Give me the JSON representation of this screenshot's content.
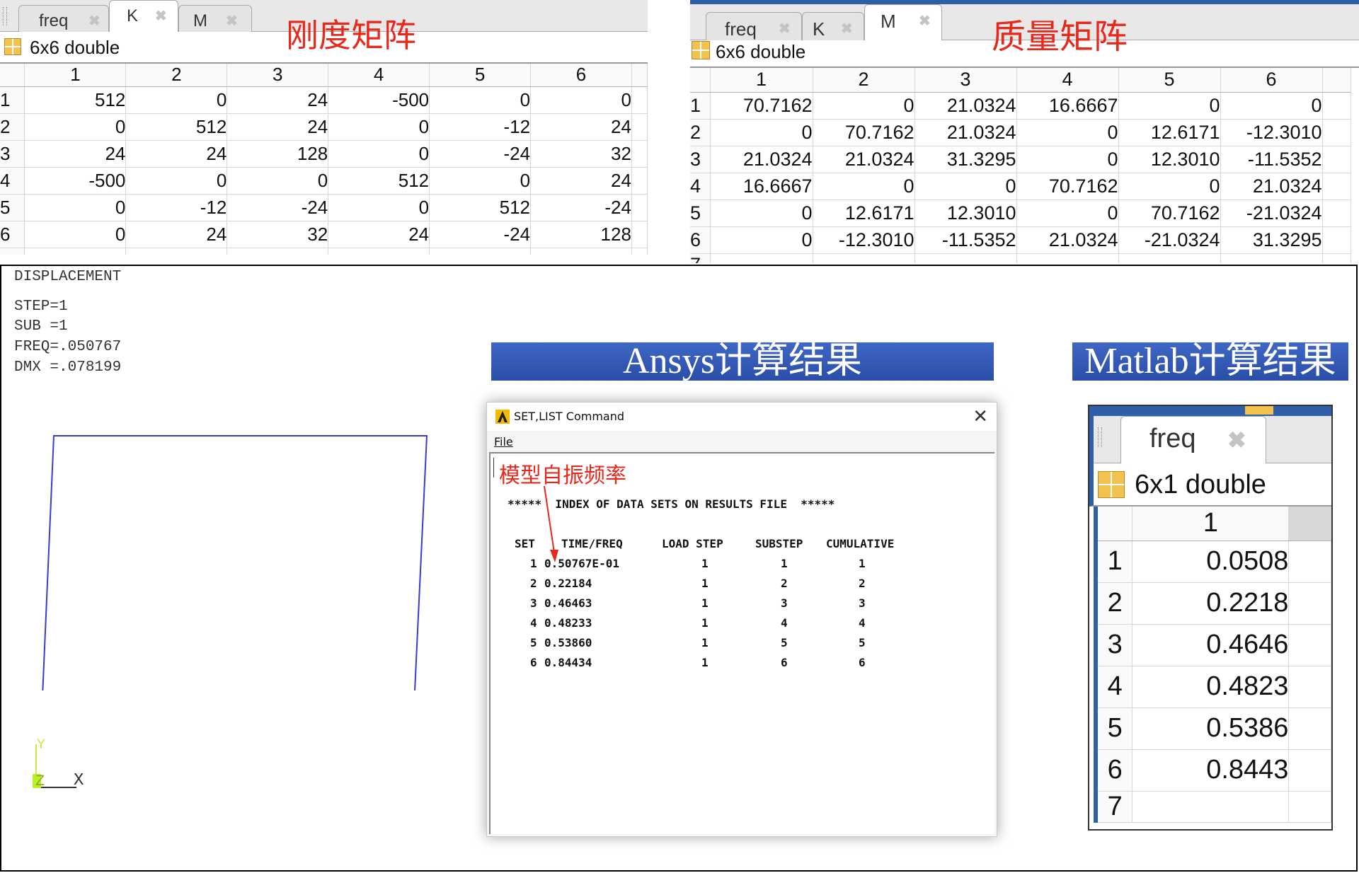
{
  "k_panel": {
    "tabs": [
      {
        "label": "freq",
        "close": "✖"
      },
      {
        "label": "K",
        "close": "✖"
      },
      {
        "label": "M",
        "close": "✖"
      }
    ],
    "active_tab": "K",
    "annotation": "刚度矩阵",
    "size_label": "6x6 double",
    "columns": [
      "1",
      "2",
      "3",
      "4",
      "5",
      "6"
    ],
    "rows": [
      {
        "idx": "1",
        "cells": [
          "512",
          "0",
          "24",
          "-500",
          "0",
          "0"
        ]
      },
      {
        "idx": "2",
        "cells": [
          "0",
          "512",
          "24",
          "0",
          "-12",
          "24"
        ]
      },
      {
        "idx": "3",
        "cells": [
          "24",
          "24",
          "128",
          "0",
          "-24",
          "32"
        ]
      },
      {
        "idx": "4",
        "cells": [
          "-500",
          "0",
          "0",
          "512",
          "0",
          "24"
        ]
      },
      {
        "idx": "5",
        "cells": [
          "0",
          "-12",
          "-24",
          "0",
          "512",
          "-24"
        ]
      },
      {
        "idx": "6",
        "cells": [
          "0",
          "24",
          "32",
          "24",
          "-24",
          "128"
        ]
      }
    ]
  },
  "m_panel": {
    "tabs": [
      {
        "label": "freq",
        "close": "✖"
      },
      {
        "label": "K",
        "close": "✖"
      },
      {
        "label": "M",
        "close": "✖"
      }
    ],
    "active_tab": "M",
    "annotation": "质量矩阵",
    "size_label": "6x6 double",
    "columns": [
      "1",
      "2",
      "3",
      "4",
      "5",
      "6"
    ],
    "rows": [
      {
        "idx": "1",
        "cells": [
          "70.7162",
          "0",
          "21.0324",
          "16.6667",
          "0",
          "0"
        ]
      },
      {
        "idx": "2",
        "cells": [
          "0",
          "70.7162",
          "21.0324",
          "0",
          "12.6171",
          "-12.3010"
        ]
      },
      {
        "idx": "3",
        "cells": [
          "21.0324",
          "21.0324",
          "31.3295",
          "0",
          "12.3010",
          "-11.5352"
        ]
      },
      {
        "idx": "4",
        "cells": [
          "16.6667",
          "0",
          "0",
          "70.7162",
          "0",
          "21.0324"
        ]
      },
      {
        "idx": "5",
        "cells": [
          "0",
          "12.6171",
          "12.3010",
          "0",
          "70.7162",
          "-21.0324"
        ]
      },
      {
        "idx": "6",
        "cells": [
          "0",
          "-12.3010",
          "-11.5352",
          "21.0324",
          "-21.0324",
          "31.3295"
        ]
      }
    ],
    "partial_row": "7"
  },
  "ansys_plot": {
    "lines": [
      "DISPLACEMENT",
      "STEP=1",
      "SUB =1",
      "FREQ=.050767",
      "DMX =.078199"
    ],
    "axis_x": "X",
    "axis_y": "Y",
    "axis_z": "Z"
  },
  "banner_ansys": "Ansys计算结果",
  "banner_matlab": "Matlab计算结果",
  "setlist_dialog": {
    "title": "SET,LIST Command",
    "close": "✕",
    "menu_file": "File",
    "annotation": "模型自振频率",
    "header_line": "*****  INDEX OF DATA SETS ON RESULTS FILE  *****",
    "columns": [
      "SET",
      "TIME/FREQ",
      "LOAD STEP",
      "SUBSTEP",
      "CUMULATIVE"
    ],
    "rows": [
      {
        "set": "1",
        "freq": "0.50767E-01",
        "load_step": "1",
        "substep": "1",
        "cumulative": "1"
      },
      {
        "set": "2",
        "freq": "0.22184",
        "load_step": "1",
        "substep": "2",
        "cumulative": "2"
      },
      {
        "set": "3",
        "freq": "0.46463",
        "load_step": "1",
        "substep": "3",
        "cumulative": "3"
      },
      {
        "set": "4",
        "freq": "0.48233",
        "load_step": "1",
        "substep": "4",
        "cumulative": "4"
      },
      {
        "set": "5",
        "freq": "0.53860",
        "load_step": "1",
        "substep": "5",
        "cumulative": "5"
      },
      {
        "set": "6",
        "freq": "0.84434",
        "load_step": "1",
        "substep": "6",
        "cumulative": "6"
      }
    ]
  },
  "freq_panel": {
    "tab": {
      "label": "freq",
      "close": "✖"
    },
    "size_label": "6x1 double",
    "columns": [
      "1"
    ],
    "rows": [
      {
        "idx": "1",
        "cells": [
          "0.0508"
        ]
      },
      {
        "idx": "2",
        "cells": [
          "0.2218"
        ]
      },
      {
        "idx": "3",
        "cells": [
          "0.4646"
        ]
      },
      {
        "idx": "4",
        "cells": [
          "0.4823"
        ]
      },
      {
        "idx": "5",
        "cells": [
          "0.5386"
        ]
      },
      {
        "idx": "6",
        "cells": [
          "0.8443"
        ]
      }
    ],
    "partial_row": "7"
  },
  "colors": {
    "annotation_red": "#e8281b",
    "banner_blue": "#2f55b0",
    "frame_blue": "#3a3ad0"
  }
}
